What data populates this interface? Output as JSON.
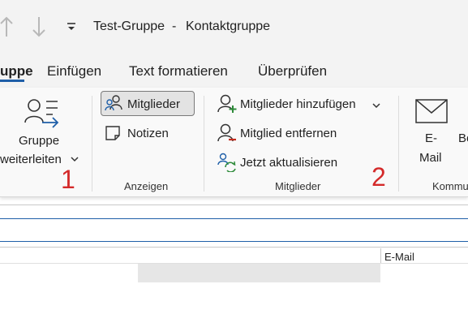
{
  "window": {
    "title_name": "Test-Gruppe",
    "title_sep": "-",
    "title_type": "Kontaktgruppe",
    "quick_access": [
      "up-arrow-icon",
      "down-arrow-icon",
      "customize-qat-icon"
    ]
  },
  "menu": {
    "tabs": [
      "uppe",
      "Einfügen",
      "Text formatieren",
      "Überprüfen"
    ],
    "active_tab": "uppe"
  },
  "ribbon": {
    "forward_group": {
      "label_line1": "Gruppe",
      "label_line2": "weiterleiten",
      "icon": "forward-group-icon",
      "marker": "1"
    },
    "anzeigen_group": {
      "buttons": [
        {
          "label": "Mitglieder",
          "icon": "members-icon",
          "selected": true
        },
        {
          "label": "Notizen",
          "icon": "notes-icon",
          "selected": false
        }
      ],
      "group_label": "Anzeigen"
    },
    "mitglieder_group": {
      "buttons": [
        {
          "label": "Mitglieder hinzufügen",
          "icon": "add-member-icon",
          "dropdown": true
        },
        {
          "label": "Mitglied entfernen",
          "icon": "remove-member-icon"
        },
        {
          "label": "Jetzt aktualisieren",
          "icon": "refresh-members-icon"
        }
      ],
      "group_label": "Mitglieder",
      "marker": "2"
    },
    "kommunizieren_group": {
      "email_line1": "E-",
      "email_line2": "Mail",
      "partial_button": "Be",
      "group_label": "Kommu"
    }
  },
  "content": {
    "column_header": "E-Mail"
  },
  "colors": {
    "accent": "#1f5fa8",
    "marker_red": "#d42a2a",
    "icon_green": "#2e8b3a",
    "icon_red": "#c42b1c"
  }
}
